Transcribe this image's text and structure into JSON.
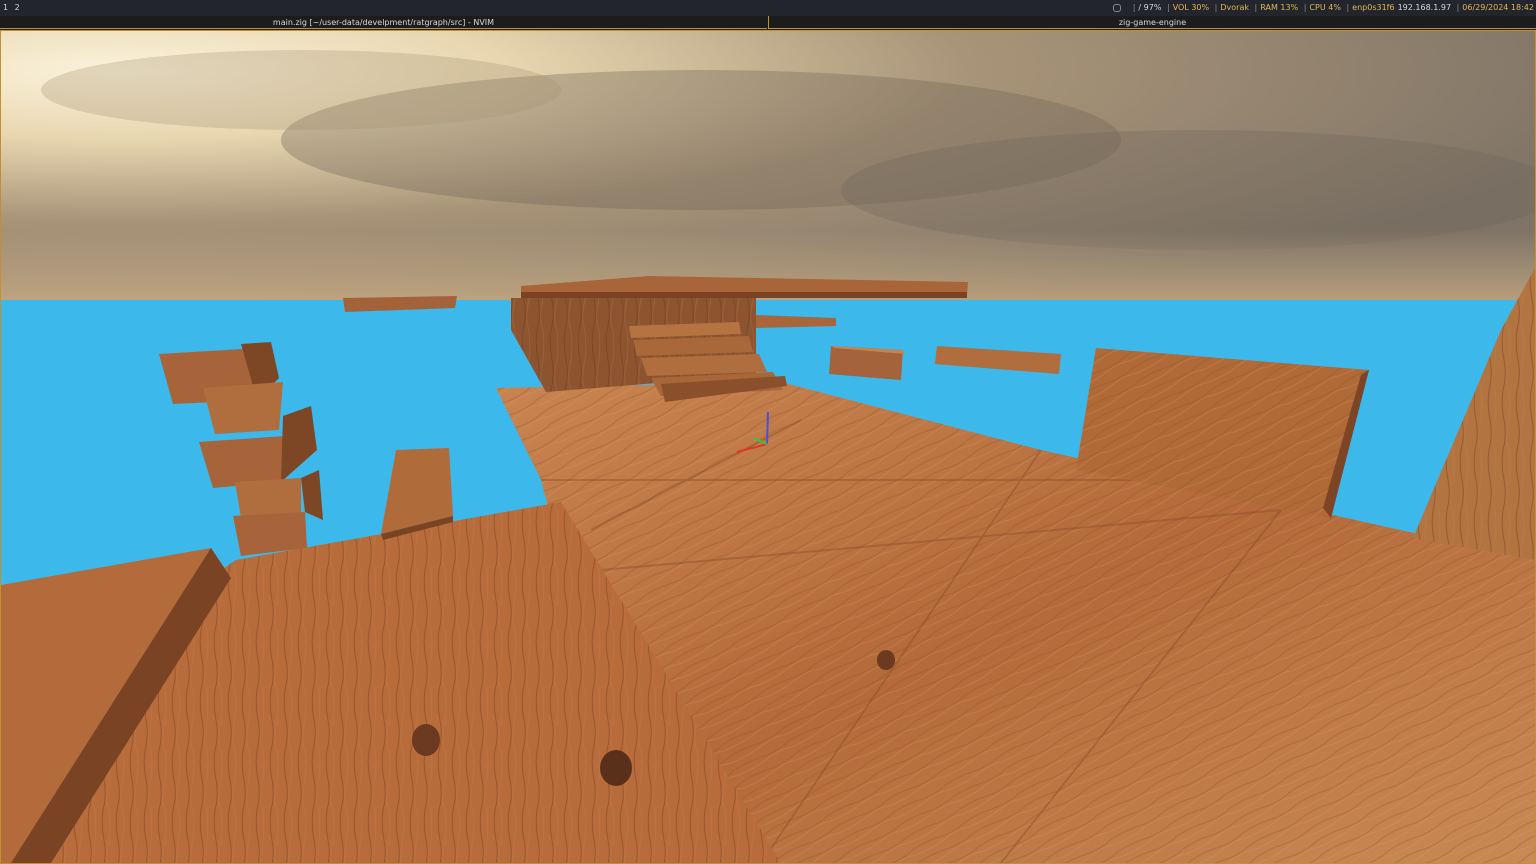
{
  "topbar": {
    "workspaces": [
      "1",
      "2"
    ],
    "status": {
      "disk": "/ 97%",
      "volume": "VOL 30%",
      "layout": "Dvorak",
      "ram": "RAM 13%",
      "cpu": "CPU  4%",
      "net_iface": "enp0s31f6",
      "net_ip": "192.168.1.97",
      "datetime": "06/29/2024 18:42"
    }
  },
  "windows": [
    {
      "title": "main.zig [~/user-data/develpment/ratgraph/src] - NVIM"
    },
    {
      "title": "zig-game-engine"
    }
  ],
  "scene": {
    "sky_top": "#8c7d6a",
    "sky_glow": "#f4e7c8",
    "floor_color": "#3cb8ea",
    "wood_light": "#c07a48",
    "wood_dark": "#6e3f22",
    "gizmo_axes": [
      "x-axis",
      "y-axis",
      "z-axis"
    ]
  }
}
